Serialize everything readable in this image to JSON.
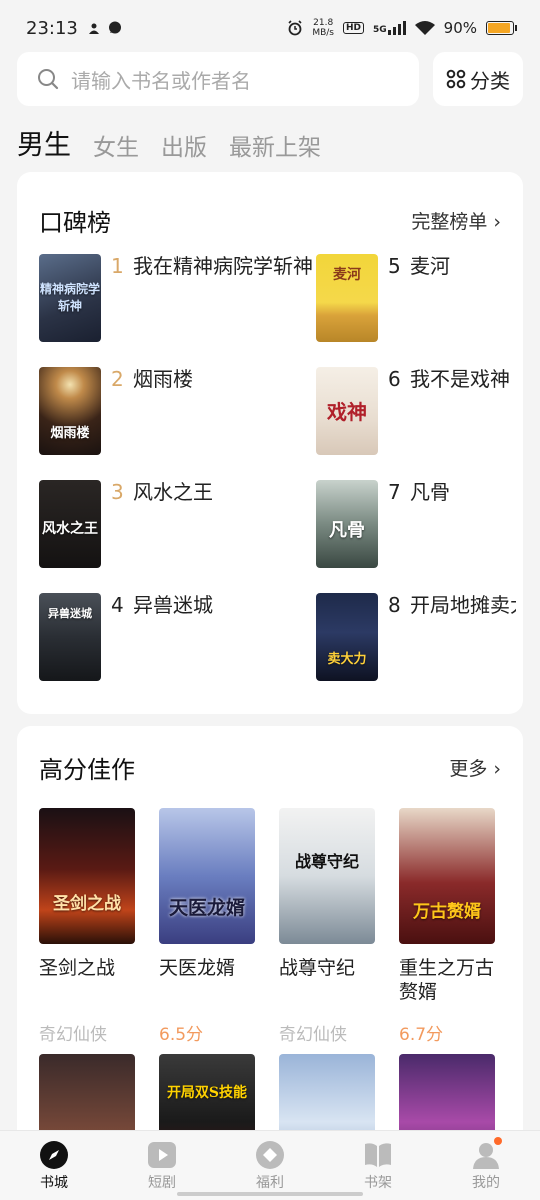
{
  "status": {
    "time": "23:13",
    "speed_value": "21.8",
    "speed_unit": "MB/s",
    "hd": "HD",
    "network": "5G",
    "battery": "90%",
    "battery_level": 0.9
  },
  "search": {
    "placeholder": "请输入书名或作者名",
    "category_label": "分类"
  },
  "tabs": [
    {
      "label": "男生",
      "active": true
    },
    {
      "label": "女生",
      "active": false
    },
    {
      "label": "出版",
      "active": false
    },
    {
      "label": "最新上架",
      "active": false
    }
  ],
  "rank_section": {
    "title": "口碑榜",
    "more_label": "完整榜单 ›",
    "items": [
      {
        "rank": "1",
        "name": "我在精神病院学斩神",
        "cover_text": "精神病院学斩神"
      },
      {
        "rank": "5",
        "name": "麦河",
        "cover_text": "麦河"
      },
      {
        "rank": "2",
        "name": "烟雨楼",
        "cover_text": "烟雨楼"
      },
      {
        "rank": "6",
        "name": "我不是戏神",
        "cover_text": "戏神"
      },
      {
        "rank": "3",
        "name": "风水之王",
        "cover_text": "风水之王"
      },
      {
        "rank": "7",
        "name": "凡骨",
        "cover_text": "凡骨"
      },
      {
        "rank": "4",
        "name": "异兽迷城",
        "cover_text": "异兽迷城"
      },
      {
        "rank": "8",
        "name": "开局地摊卖大力",
        "cover_text": "卖大力"
      }
    ]
  },
  "high_score": {
    "title": "高分佳作",
    "more_label": "更多 ›",
    "books": [
      {
        "name": "圣剑之战",
        "meta": "奇幻仙侠",
        "cover_text": "圣剑之战"
      },
      {
        "name": "天医龙婿",
        "meta": "6.5分",
        "cover_text": "天医龙婿"
      },
      {
        "name": "战尊守纪",
        "meta": "奇幻仙侠",
        "cover_text": "战尊守纪"
      },
      {
        "name": "重生之万古赘婿",
        "meta": "6.7分",
        "cover_text": "万古赘婿"
      }
    ],
    "books_row2_covers": [
      "",
      "开局双S技能",
      "",
      ""
    ]
  },
  "bottom_nav": [
    {
      "label": "书城",
      "icon": "compass-icon",
      "active": true
    },
    {
      "label": "短剧",
      "icon": "play-icon",
      "active": false
    },
    {
      "label": "福利",
      "icon": "gift-icon",
      "active": false
    },
    {
      "label": "书架",
      "icon": "book-icon",
      "active": false
    },
    {
      "label": "我的",
      "icon": "user-icon",
      "active": false
    }
  ]
}
